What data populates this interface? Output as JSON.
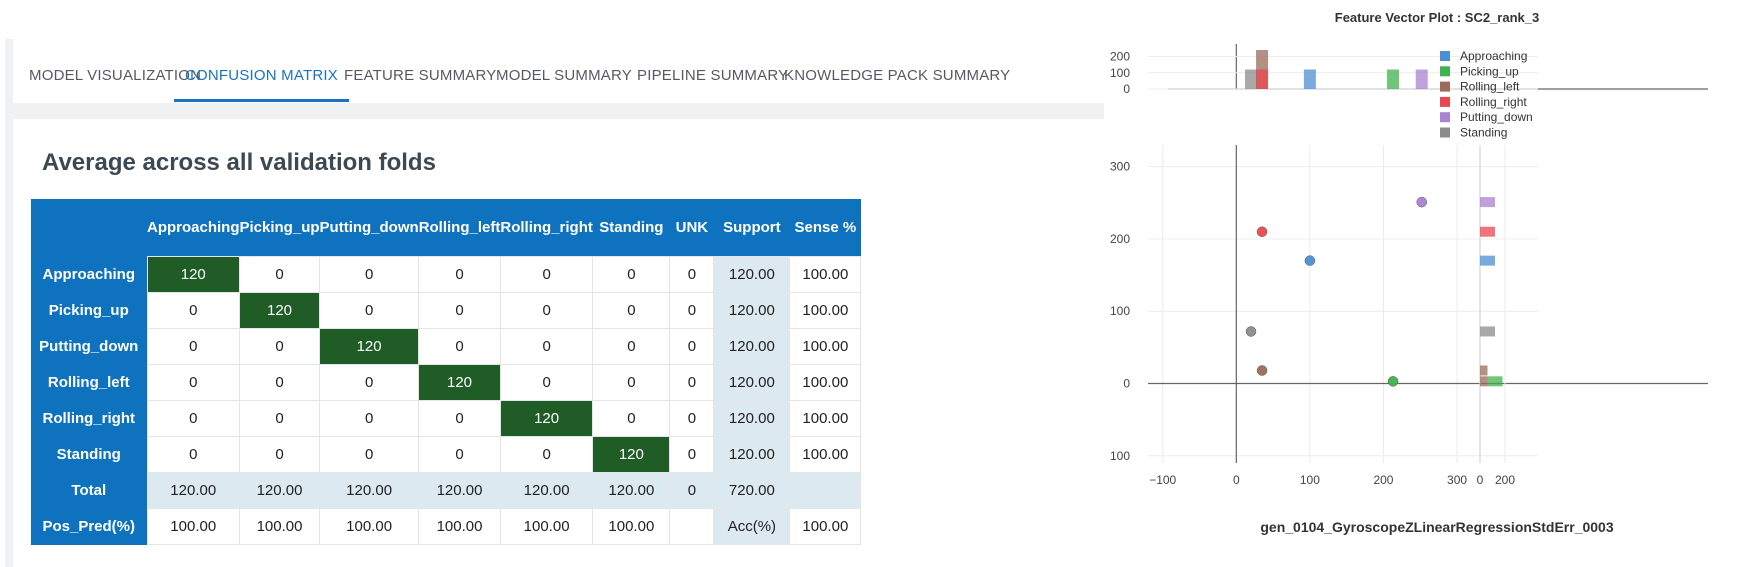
{
  "tabs": [
    {
      "label": "MODEL VISUALIZATION",
      "active": false
    },
    {
      "label": "CONFUSION MATRIX",
      "active": true
    },
    {
      "label": "FEATURE SUMMARY",
      "active": false
    },
    {
      "label": "MODEL SUMMARY",
      "active": false
    },
    {
      "label": "PIPELINE SUMMARY",
      "active": false
    },
    {
      "label": "KNOWLEDGE PACK SUMMARY",
      "active": false
    }
  ],
  "confusion": {
    "heading": "Average across all validation folds",
    "columns": [
      "Approaching",
      "Picking_up",
      "Putting_down",
      "Rolling_left",
      "Rolling_right",
      "Standing",
      "UNK",
      "Support",
      "Sense %"
    ],
    "rows": [
      {
        "label": "Approaching",
        "cells": [
          "120",
          "0",
          "0",
          "0",
          "0",
          "0",
          "0",
          "120.00",
          "100.00"
        ]
      },
      {
        "label": "Picking_up",
        "cells": [
          "0",
          "120",
          "0",
          "0",
          "0",
          "0",
          "0",
          "120.00",
          "100.00"
        ]
      },
      {
        "label": "Putting_down",
        "cells": [
          "0",
          "0",
          "120",
          "0",
          "0",
          "0",
          "0",
          "120.00",
          "100.00"
        ]
      },
      {
        "label": "Rolling_left",
        "cells": [
          "0",
          "0",
          "0",
          "120",
          "0",
          "0",
          "0",
          "120.00",
          "100.00"
        ]
      },
      {
        "label": "Rolling_right",
        "cells": [
          "0",
          "0",
          "0",
          "0",
          "120",
          "0",
          "0",
          "120.00",
          "100.00"
        ]
      },
      {
        "label": "Standing",
        "cells": [
          "0",
          "0",
          "0",
          "0",
          "0",
          "120",
          "0",
          "120.00",
          "100.00"
        ]
      },
      {
        "label": "Total",
        "cells": [
          "120.00",
          "120.00",
          "120.00",
          "120.00",
          "120.00",
          "120.00",
          "0",
          "720.00",
          ""
        ]
      },
      {
        "label": "Pos_Pred(%)",
        "cells": [
          "100.00",
          "100.00",
          "100.00",
          "100.00",
          "100.00",
          "100.00",
          "",
          "Acc(%)",
          "100.00"
        ]
      }
    ]
  },
  "colors": {
    "accent": "#1a73c2",
    "header": "#0f72bf",
    "diagonal": "#1f5c26",
    "support": "#dde9f1"
  },
  "plot": {
    "title": "Feature Vector Plot : SC2_rank_3",
    "xlabel": "gen_0104_GyroscopeZLinearRegressionStdErr_0003"
  },
  "chart_data": {
    "type": "scatter",
    "title": "Feature Vector Plot : SC2_rank_3",
    "xlabel": "gen_0104_GyroscopeZLinearRegressionStdErr_0003",
    "ylabel": "",
    "xlim": [
      -120,
      410
    ],
    "ylim": [
      -110,
      330
    ],
    "xticks": [
      "−100",
      "0",
      "100",
      "200",
      "300"
    ],
    "xtick_values": [
      -100,
      0,
      100,
      200,
      300
    ],
    "yticks": [
      "−100",
      "0",
      "100",
      "200",
      "300"
    ],
    "ytick_values": [
      -100,
      0,
      100,
      200,
      300
    ],
    "grid": true,
    "legend_position": "top-right",
    "series": [
      {
        "name": "Approaching",
        "color": "#4e8fd1",
        "points": [
          [
            100,
            170
          ]
        ]
      },
      {
        "name": "Picking_up",
        "color": "#3fb34f",
        "points": [
          [
            213,
            3
          ]
        ]
      },
      {
        "name": "Rolling_left",
        "color": "#9a6b5b",
        "points": [
          [
            35,
            18
          ]
        ]
      },
      {
        "name": "Rolling_right",
        "color": "#e8474f",
        "points": [
          [
            35,
            210
          ]
        ]
      },
      {
        "name": "Putting_down",
        "color": "#a883d3",
        "points": [
          [
            252,
            251
          ]
        ]
      },
      {
        "name": "Standing",
        "color": "#8c8c8c",
        "points": [
          [
            20,
            72
          ]
        ]
      }
    ],
    "top_histogram": {
      "yticks": [
        "0",
        "100",
        "200"
      ],
      "ytick_values": [
        0,
        100,
        200
      ],
      "ylim": [
        0,
        240
      ],
      "bars": [
        {
          "series": "Standing",
          "x": 20,
          "count": 120
        },
        {
          "series": "Rolling_left",
          "x": 35,
          "count": 240
        },
        {
          "series": "Rolling_right",
          "x": 35,
          "count": 120
        },
        {
          "series": "Approaching",
          "x": 100,
          "count": 120
        },
        {
          "series": "Picking_up",
          "x": 213,
          "count": 120
        },
        {
          "series": "Putting_down",
          "x": 252,
          "count": 120
        }
      ]
    },
    "right_histogram": {
      "xticks": [
        "0",
        "200"
      ],
      "xtick_values": [
        0,
        200
      ],
      "xlim": [
        0,
        240
      ],
      "bars": [
        {
          "series": "Putting_down",
          "y": 251,
          "count": 120
        },
        {
          "series": "Rolling_right",
          "y": 210,
          "count": 120
        },
        {
          "series": "Approaching",
          "y": 170,
          "count": 120
        },
        {
          "series": "Standing",
          "y": 72,
          "count": 120
        },
        {
          "series": "Rolling_left",
          "y": 18,
          "count": 60
        },
        {
          "series": "Rolling_left",
          "y": 3,
          "count": 60
        },
        {
          "series": "Picking_up",
          "y": 3,
          "count": 120
        }
      ]
    }
  }
}
